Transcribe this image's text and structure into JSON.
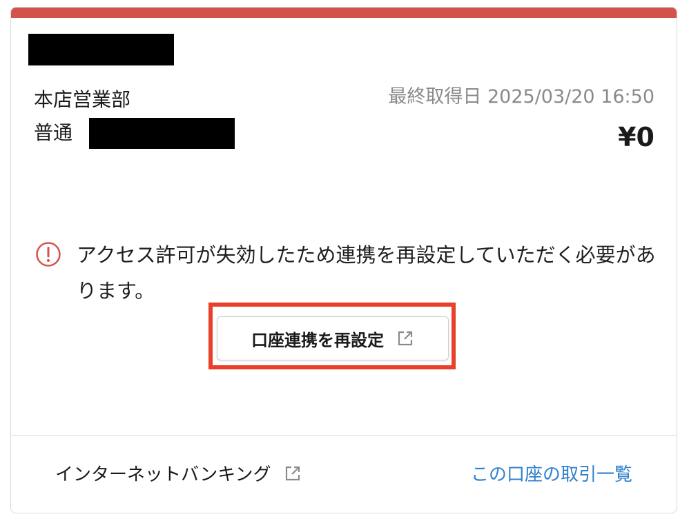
{
  "account": {
    "branch": "本店営業部",
    "type": "普通",
    "last_fetched_label": "最終取得日",
    "last_fetched_value": "2025/03/20 16:50",
    "balance": "¥0"
  },
  "alert": {
    "icon": "alert-circle-icon",
    "message": "アクセス許可が失効したため連携を再設定していただく必要があります。",
    "color": "#d4524c"
  },
  "relink_button": {
    "label": "口座連携を再設定",
    "icon": "external-link-icon"
  },
  "footer": {
    "internet_banking_label": "インターネットバンキング",
    "internet_banking_icon": "external-link-icon",
    "transactions_link_label": "この口座の取引一覧"
  },
  "colors": {
    "accent_bar": "#d4524c",
    "link": "#2f7fcc",
    "highlight_border": "#e8402a",
    "muted_text": "#8a8a8a"
  }
}
